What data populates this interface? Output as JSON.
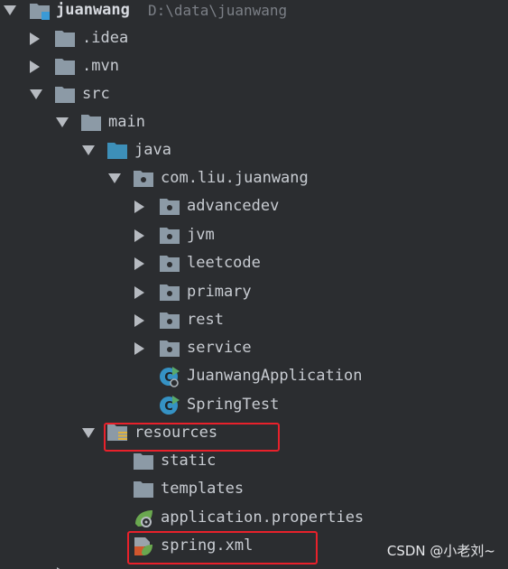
{
  "tree": {
    "root": {
      "label": "juanwang",
      "path": "D:\\data\\juanwang"
    },
    "idea": {
      "label": ".idea"
    },
    "mvn": {
      "label": ".mvn"
    },
    "src": {
      "label": "src"
    },
    "main": {
      "label": "main"
    },
    "java": {
      "label": "java"
    },
    "pkg": {
      "label": "com.liu.juanwang"
    },
    "advancedev": {
      "label": "advancedev"
    },
    "jvm": {
      "label": "jvm"
    },
    "leetcode": {
      "label": "leetcode"
    },
    "primary": {
      "label": "primary"
    },
    "rest": {
      "label": "rest"
    },
    "service": {
      "label": "service"
    },
    "app_class": {
      "label": "JuanwangApplication"
    },
    "test_class": {
      "label": "SpringTest"
    },
    "resources": {
      "label": "resources"
    },
    "static": {
      "label": "static"
    },
    "templates": {
      "label": "templates"
    },
    "app_props": {
      "label": "application.properties"
    },
    "spring_xml": {
      "label": "spring.xml"
    }
  },
  "watermark": {
    "text": "CSDN @小老刘~"
  },
  "colors": {
    "background": "#2b2d30",
    "folder": "#8c9aa6",
    "source_folder": "#3d8fb8",
    "class_icon": "#3592c4",
    "spring_green": "#6aa84f",
    "highlight_box": "#e8212b"
  }
}
